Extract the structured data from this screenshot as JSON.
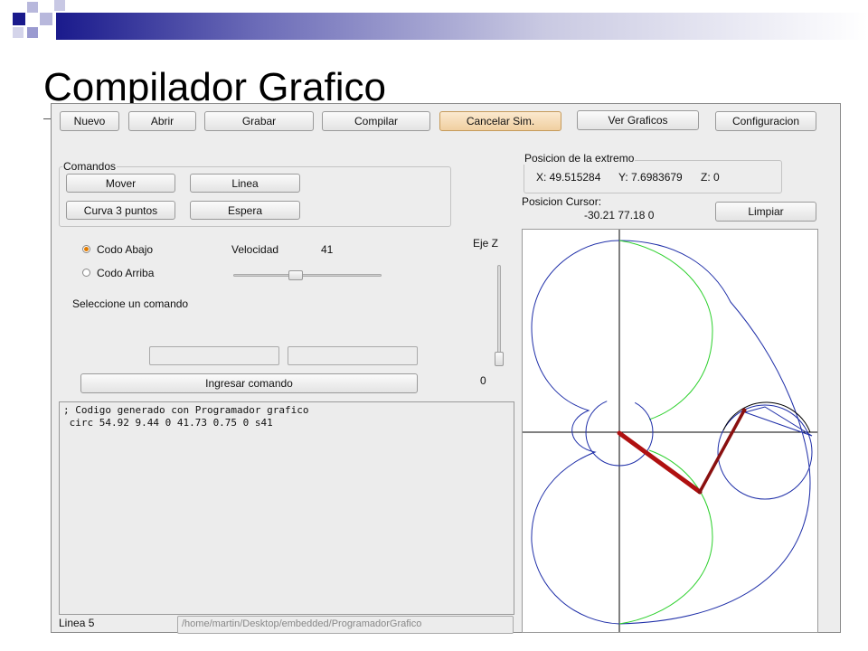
{
  "slide": {
    "title": "Compilador Grafico",
    "colors": {
      "banner_dark": "#1a1a8c",
      "square_light": "#b8b8dc"
    }
  },
  "toolbar": {
    "nuevo": "Nuevo",
    "abrir": "Abrir",
    "grabar": "Grabar",
    "compilar": "Compilar",
    "cancelar": "Cancelar Sim.",
    "ver_graficos": "Ver Graficos",
    "configuracion": "Configuracion"
  },
  "comandos": {
    "title": "Comandos",
    "mover": "Mover",
    "linea": "Linea",
    "curva": "Curva 3 puntos",
    "espera": "Espera"
  },
  "codo": {
    "abajo": "Codo Abajo",
    "arriba": "Codo Arriba",
    "selected": "Codo Abajo"
  },
  "velocidad": {
    "label": "Velocidad",
    "value": "41",
    "fraction": 0.41
  },
  "eje_z": {
    "label": "Eje Z",
    "value": "0",
    "fraction": 0.0
  },
  "prompt": "Seleccione un comando",
  "ingresar": "Ingresar comando",
  "editor": {
    "lines": [
      "; Codigo generado con Programador grafico",
      "",
      " circ 54.92 9.44 0 41.73 0.75 0 s41"
    ]
  },
  "status": {
    "linea": "Linea 5",
    "path": "/home/martin/Desktop/embedded/ProgramadorGrafico"
  },
  "extremo": {
    "title": "Posicion de la extremo",
    "x": "X:  49.515284",
    "y": "Y:  7.6983679",
    "z": "Z:  0"
  },
  "cursor": {
    "label": "Posicion Cursor:",
    "value": "-30.21 77.18 0"
  },
  "limpiar": "Limpiar",
  "plot_colors": {
    "workspace": "#1e2ea8",
    "inner_arc": "#2bd02b",
    "arm": "#a01010",
    "axes": "#000000"
  }
}
